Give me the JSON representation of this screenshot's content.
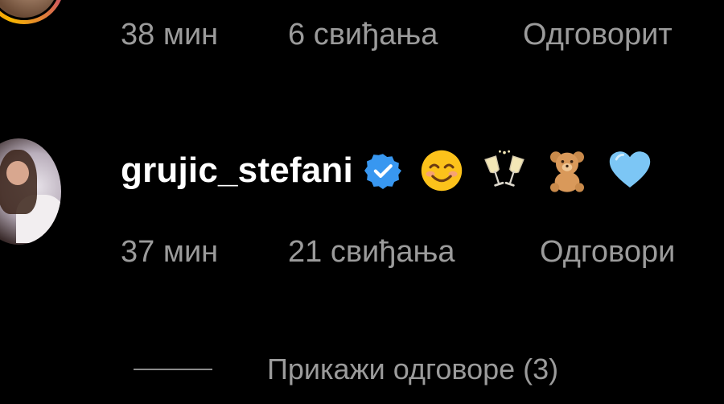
{
  "previous_comment": {
    "time": "38 мин",
    "likes": "6 свиђања",
    "reply": "Одговорит"
  },
  "comment": {
    "username": "grujic_stefani",
    "emojis": [
      "smiling-face-icon",
      "clinking-glasses-icon",
      "teddy-bear-icon",
      "light-blue-heart-icon"
    ],
    "time": "37 мин",
    "likes": "21 свиђања",
    "reply": "Одговори",
    "view_replies": "Прикажи одговоре (3)"
  },
  "colors": {
    "background": "#000000",
    "username": "#ffffff",
    "meta_text": "#9b9b9b",
    "verified_badge": "#3897f0",
    "heart": "#7cc6f5"
  }
}
